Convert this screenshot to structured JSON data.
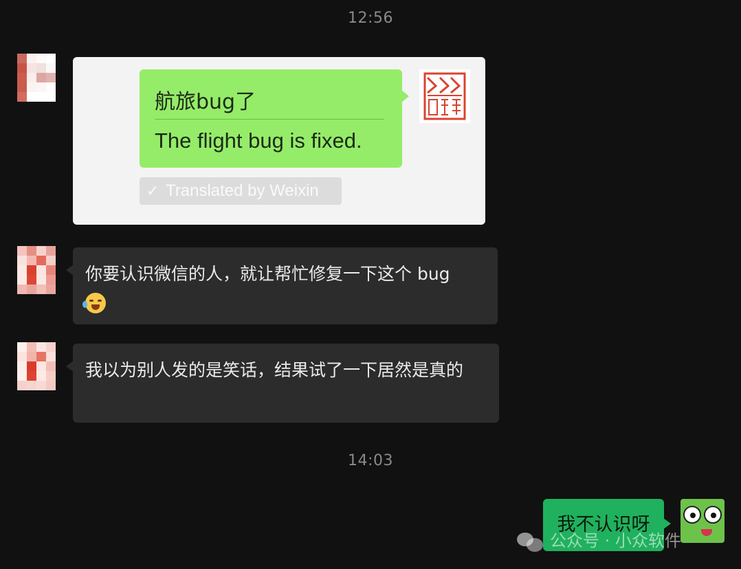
{
  "timestamps": [
    "12:56",
    "14:03"
  ],
  "messages": [
    {
      "type": "image",
      "inner_text": "航旅bug了",
      "inner_translation": "The flight bug is fixed.",
      "translated_label": "Translated by Weixin"
    },
    {
      "type": "text",
      "text": "你要认识微信的人，就让帮忙修复一下这个 bug",
      "emoji": "face-with-tears-of-joy"
    },
    {
      "type": "text",
      "text": "我以为别人发的是笑话，结果试了一下居然是真的"
    },
    {
      "type": "text",
      "direction": "outgoing",
      "text": "我不认识呀"
    }
  ],
  "watermark": "公众号 · 小众软件",
  "colors": {
    "background": "#111111",
    "incoming_bubble": "#2c2c2c",
    "outgoing_bubble": "#20b15e",
    "inner_bubble": "#95ec69"
  }
}
